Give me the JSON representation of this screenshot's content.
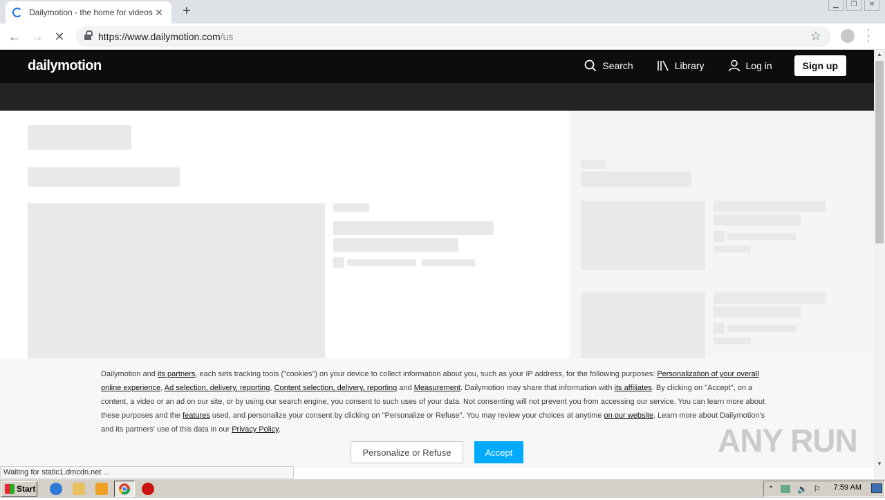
{
  "browser": {
    "tab_title": "Dailymotion - the home for videos th",
    "url_host": "https://www.dailymotion.com",
    "url_path": "/us"
  },
  "site": {
    "logo": "dailymotion",
    "nav": {
      "search": "Search",
      "library": "Library",
      "login": "Log in",
      "signup": "Sign up"
    }
  },
  "cookie": {
    "p1": "Dailymotion and ",
    "link_partners": "its partners",
    "p2": ", each sets tracking tools (\"cookies\") on your device to collect information about you, such as your IP address, for the following purposes: ",
    "link_personalization": "Personalization of your overall online experience",
    "p3": ", ",
    "link_ads": "Ad selection, delivery, reporting",
    "p4": ", ",
    "link_content": "Content selection, delivery, reporting",
    "p5": " and ",
    "link_measurement": "Measurement",
    "p6": ". Dailymotion may share that information with ",
    "link_affiliates": "its affiliates",
    "p7": ". By clicking on \"Accept\", on a content, a video or an ad on our site, or by using our search engine, you consent to such uses of your data. Not consenting will not prevent you from accessing our service. You can learn more about these purposes and the ",
    "link_features": "features",
    "p8": " used, and personalize your consent by clicking on \"Personalize or Refuse\". You may review your choices at anytime ",
    "link_website": "on our website",
    "p9": ". Learn more about Dailymotion's and its partners' use of this data in our ",
    "link_privacy": "Privacy Policy",
    "p10": ".",
    "refuse_label": "Personalize or Refuse",
    "accept_label": "Accept"
  },
  "watermark": "ANY RUN",
  "status_text": "Waiting for static1.dmcdn.net ...",
  "taskbar": {
    "start": "Start",
    "clock": "7:59 AM"
  },
  "colors": {
    "accent": "#00aaff",
    "header_bg": "#0d0d0d",
    "subbar_bg": "#232323"
  }
}
